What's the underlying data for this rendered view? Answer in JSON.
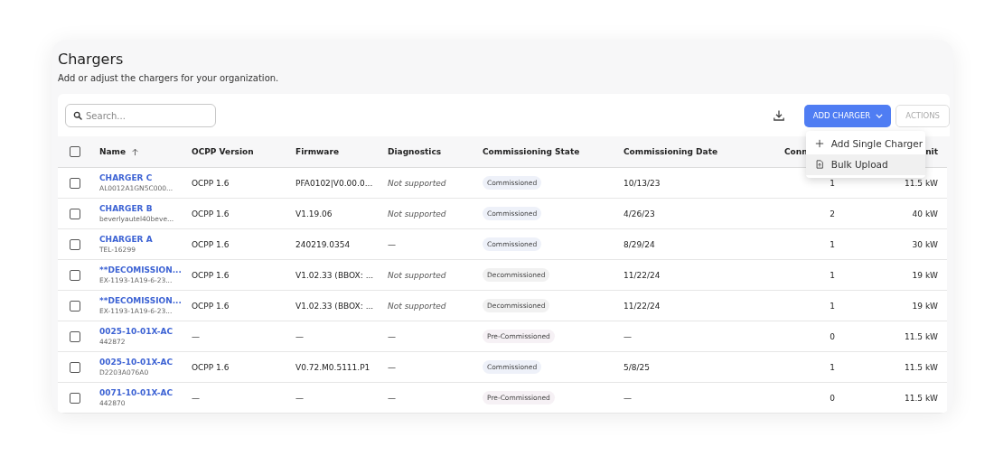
{
  "header": {
    "title": "Chargers",
    "subtitle": "Add or adjust the chargers for your organization."
  },
  "search": {
    "placeholder": "Search..."
  },
  "toolbar": {
    "add_button": "ADD CHARGER",
    "actions_button": {
      "label": "ACTIONS",
      "disabled": true
    }
  },
  "add_menu": {
    "expanded": true,
    "items": [
      {
        "label": "Add Single Charger",
        "kind": "add",
        "selected": false
      },
      {
        "label": "Bulk Upload",
        "kind": "upload",
        "selected": true
      }
    ]
  },
  "table": {
    "select_all": {
      "checked": false
    },
    "columns": [
      {
        "label": "Name",
        "sorted": true
      },
      {
        "label": "OCPP Version",
        "sorted": false
      },
      {
        "label": "Firmware",
        "sorted": false
      },
      {
        "label": "Diagnostics",
        "sorted": false
      },
      {
        "label": "Commissioning State",
        "sorted": false
      },
      {
        "label": "Commissioning Date",
        "sorted": false
      },
      {
        "label": "Conn",
        "sorted": false
      },
      {
        "label": "nit",
        "sorted": false
      }
    ],
    "rows": [
      {
        "checked": false,
        "name": "CHARGER C",
        "id": "AL0012A1GN5C000...",
        "ocpp": "OCPP 1.6",
        "firmware": "PFA0102|V0.00.0...",
        "diagnostics": "Not supported",
        "state": "Commissioned",
        "color": "#eef1f9",
        "date": "10/13/23",
        "connectors": "1",
        "limit": "11.5 kW"
      },
      {
        "checked": false,
        "name": "CHARGER B",
        "id": "beverlyautel40beve...",
        "ocpp": "OCPP 1.6",
        "firmware": "V1.19.06",
        "diagnostics": "Not supported",
        "state": "Commissioned",
        "color": "#eef1f9",
        "date": "4/26/23",
        "connectors": "2",
        "limit": "40 kW"
      },
      {
        "checked": false,
        "name": "CHARGER A",
        "id": "TEL-16299",
        "ocpp": "OCPP 1.6",
        "firmware": "240219.0354",
        "diagnostics": "—",
        "state": "Commissioned",
        "color": "#eef1f9",
        "date": "8/29/24",
        "connectors": "1",
        "limit": "30 kW"
      },
      {
        "checked": false,
        "name": "**DECOMISSION...",
        "id": "EX-1193-1A19-6-23...",
        "ocpp": "OCPP 1.6",
        "firmware": "V1.02.33 (BBOX: ...",
        "diagnostics": "Not supported",
        "state": "Decommissioned",
        "color": "#f1f1f1",
        "date": "11/22/24",
        "connectors": "1",
        "limit": "19 kW"
      },
      {
        "checked": false,
        "name": "**DECOMISSION...",
        "id": "EX-1193-1A19-6-23...",
        "ocpp": "OCPP 1.6",
        "firmware": "V1.02.33 (BBOX: ...",
        "diagnostics": "Not supported",
        "state": "Decommissioned",
        "color": "#f1f1f1",
        "date": "11/22/24",
        "connectors": "1",
        "limit": "19 kW"
      },
      {
        "checked": false,
        "name": "0025-10-01X-AC",
        "id": "442872",
        "ocpp": "—",
        "firmware": "—",
        "diagnostics": "—",
        "state": "Pre-Commissioned",
        "color": "#f6f1f5",
        "date": "—",
        "connectors": "0",
        "limit": "11.5 kW"
      },
      {
        "checked": false,
        "name": "0025-10-01X-AC",
        "id": "D2203A076A0",
        "ocpp": "OCPP 1.6",
        "firmware": "V0.72.M0.5111.P1",
        "diagnostics": "—",
        "state": "Commissioned",
        "color": "#eef1f9",
        "date": "5/8/25",
        "connectors": "1",
        "limit": "11.5 kW"
      },
      {
        "checked": false,
        "name": "0071-10-01X-AC",
        "id": "442870",
        "ocpp": "—",
        "firmware": "—",
        "diagnostics": "—",
        "state": "Pre-Commissioned",
        "color": "#f6f1f5",
        "date": "—",
        "connectors": "0",
        "limit": "11.5 kW"
      }
    ]
  }
}
